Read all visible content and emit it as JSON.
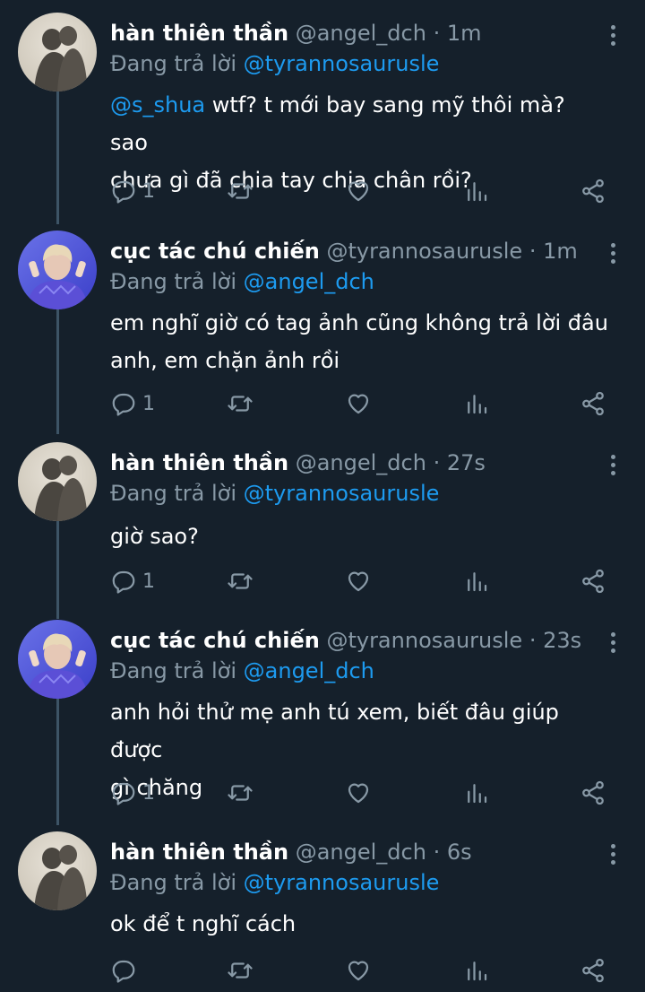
{
  "tweets": [
    {
      "name": "hàn thiên thần",
      "handle": "@angel_dch",
      "time": "1m",
      "replying_prefix": "Đang trả lời",
      "replying_to": "@tyrannosaurusle",
      "text_mention": "@s_shua",
      "text_line1": " wtf? t mới bay sang mỹ thôi mà? sao",
      "text_line2": "chưa gì đã chia tay chia chân rồi?",
      "reply_count": "1",
      "avatar": "shadow-avatar"
    },
    {
      "name": "cục tác chú chiến",
      "handle": "@tyrannosaurusle",
      "time": "1m",
      "replying_prefix": "Đang trả lời",
      "replying_to": "@angel_dch",
      "text_line1": "em nghĩ giờ có tag ảnh cũng không trả lời đâu",
      "text_line2": "anh, em chặn ảnh rồi",
      "reply_count": "1",
      "avatar": "person-avatar"
    },
    {
      "name": "hàn thiên thần",
      "handle": "@angel_dch",
      "time": "27s",
      "replying_prefix": "Đang trả lời",
      "replying_to": "@tyrannosaurusle",
      "text_line1": "giờ sao?",
      "reply_count": "1",
      "avatar": "shadow-avatar"
    },
    {
      "name": "cục tác chú chiến",
      "handle": "@tyrannosaurusle",
      "time": "23s",
      "replying_prefix": "Đang trả lời",
      "replying_to": "@angel_dch",
      "text_line1": "anh hỏi thử mẹ anh tú xem, biết đâu giúp được",
      "text_line2": "gì chăng",
      "reply_count": "1",
      "avatar": "person-avatar"
    },
    {
      "name": "hàn thiên thần",
      "handle": "@angel_dch",
      "time": "6s",
      "replying_prefix": "Đang trả lời",
      "replying_to": "@tyrannosaurusle",
      "text_line1": "ok để t nghĩ cách",
      "reply_count": "",
      "avatar": "shadow-avatar"
    }
  ],
  "colors": {
    "background": "#15202b",
    "secondary_text": "#8899a6",
    "accent": "#1d9bf0",
    "thread_line": "#3d5466"
  },
  "icons": [
    "reply-icon",
    "retweet-icon",
    "like-icon",
    "analytics-icon",
    "share-icon",
    "more-options-icon"
  ]
}
